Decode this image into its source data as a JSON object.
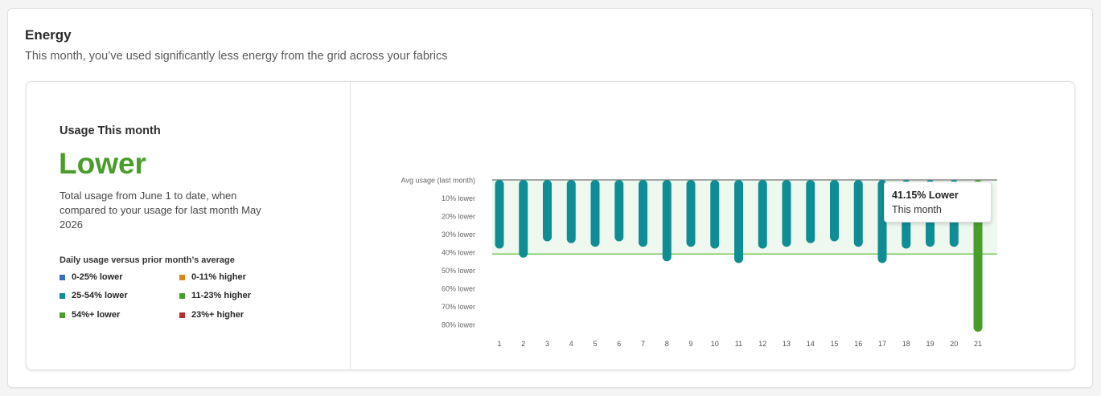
{
  "section": {
    "title": "Energy",
    "subtitle": "This month, you’ve used significantly less energy from the grid across your fabrics"
  },
  "usage": {
    "heading": "Usage This month",
    "status": "Lower",
    "description": "Total usage from June 1 to date, when compared to your usage for last month May 2026"
  },
  "legend": {
    "title": "Daily usage versus prior month’s average",
    "items": [
      {
        "label": "0-25% lower",
        "color": "#3a6fc0"
      },
      {
        "label": "0-11% higher",
        "color": "#d48a1a"
      },
      {
        "label": "25-54% lower",
        "color": "#0e8e94"
      },
      {
        "label": "11-23% higher",
        "color": "#4a9d2c"
      },
      {
        "label": "54%+ lower",
        "color": "#4a9d2c"
      },
      {
        "label": "23%+ higher",
        "color": "#b3302a"
      }
    ]
  },
  "tooltip": {
    "value": "41.15% Lower",
    "label": "This month"
  },
  "colors": {
    "teal": "#0e8e94",
    "green": "#4a9d2c",
    "band": "#eef8ee",
    "threshold": "#79c95e",
    "baseline": "#8a8a8a"
  },
  "chart_data": {
    "type": "bar",
    "ylabels": [
      "Avg usage (last month)",
      "10% lower",
      "20% lower",
      "30% lower",
      "40% lower",
      "50% lower",
      "60% lower",
      "70% lower",
      "80% lower"
    ],
    "ylim": [
      0,
      80
    ],
    "threshold": 41,
    "categories": [
      "1",
      "2",
      "3",
      "4",
      "5",
      "6",
      "7",
      "8",
      "9",
      "10",
      "11",
      "12",
      "13",
      "14",
      "15",
      "16",
      "17",
      "18",
      "19",
      "20",
      "21"
    ],
    "values": [
      38,
      43,
      34,
      35,
      37,
      34,
      37,
      45,
      37,
      38,
      46,
      38,
      37,
      35,
      34,
      37,
      46,
      38,
      37,
      37,
      84
    ],
    "bar_colors": [
      "teal",
      "teal",
      "teal",
      "teal",
      "teal",
      "teal",
      "teal",
      "teal",
      "teal",
      "teal",
      "teal",
      "teal",
      "teal",
      "teal",
      "teal",
      "teal",
      "teal",
      "teal",
      "teal",
      "teal",
      "green"
    ]
  }
}
